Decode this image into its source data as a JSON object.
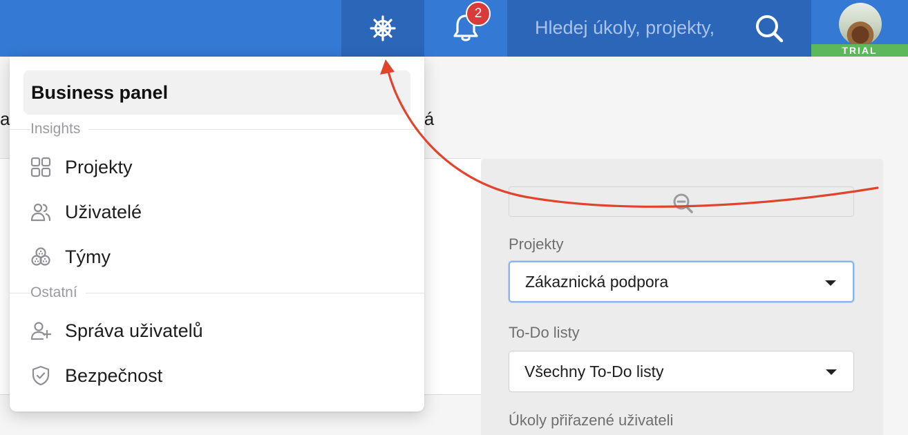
{
  "header": {
    "notifications_count": "2",
    "search_placeholder": "Hledej úkoly, projekty,",
    "account_badge": "TRIAL",
    "colors": {
      "bar": "#3479d4",
      "bar_dark": "#2b66b8",
      "badge": "#d93a3a",
      "trial": "#5db85b"
    }
  },
  "background": {
    "fragment_left": "a",
    "fragment_right": "já",
    "filters": {
      "projects_label": "Projekty",
      "projects_value": "Zákaznická podpora",
      "todo_label": "To-Do listy",
      "todo_value": "Všechny To-Do listy",
      "assigned_label": "Úkoly přiřazené uživateli"
    }
  },
  "menu": {
    "title": "Business panel",
    "sections": [
      {
        "label": "Insights",
        "items": [
          {
            "label": "Projekty",
            "icon": "grid-icon"
          },
          {
            "label": "Uživatelé",
            "icon": "users-icon"
          },
          {
            "label": "Týmy",
            "icon": "teams-icon"
          }
        ]
      },
      {
        "label": "Ostatní",
        "items": [
          {
            "label": "Správa uživatelů",
            "icon": "user-plus-icon"
          },
          {
            "label": "Bezpečnost",
            "icon": "shield-icon"
          }
        ]
      }
    ]
  },
  "annotation": {
    "color": "#e0442c"
  }
}
